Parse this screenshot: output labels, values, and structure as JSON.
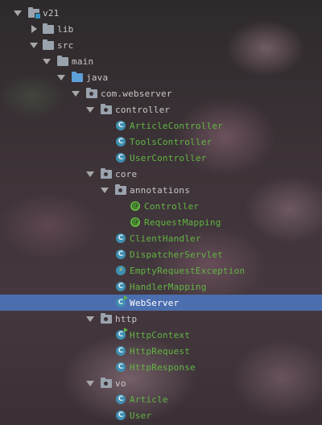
{
  "colors": {
    "selection": "#4b6eaf",
    "class_icon": "#3e8fb0",
    "annotation_icon": "#62b543",
    "changed_file_text": "#62b543",
    "plain_text": "#c8c8c8"
  },
  "tree": [
    {
      "label": "v21",
      "expanded": true,
      "icon": "module-folder-icon",
      "style": "plain"
    },
    {
      "label": "lib",
      "expanded": false,
      "icon": "folder-icon",
      "style": "plain"
    },
    {
      "label": "src",
      "expanded": true,
      "icon": "folder-icon",
      "style": "plain"
    },
    {
      "label": "main",
      "expanded": true,
      "icon": "folder-icon",
      "style": "plain"
    },
    {
      "label": "java",
      "expanded": true,
      "icon": "source-folder-icon",
      "style": "plain"
    },
    {
      "label": "com.webserver",
      "expanded": true,
      "icon": "package-icon",
      "style": "plain"
    },
    {
      "label": "controller",
      "expanded": true,
      "icon": "package-icon",
      "style": "plain"
    },
    {
      "label": "ArticleController",
      "icon": "class-icon",
      "style": "green"
    },
    {
      "label": "ToolsController",
      "icon": "class-icon",
      "style": "green"
    },
    {
      "label": "UserController",
      "icon": "class-icon",
      "style": "green"
    },
    {
      "label": "core",
      "expanded": true,
      "icon": "package-icon",
      "style": "plain"
    },
    {
      "label": "annotations",
      "expanded": true,
      "icon": "package-icon",
      "style": "plain"
    },
    {
      "label": "Controller",
      "icon": "annotation-icon",
      "style": "green"
    },
    {
      "label": "RequestMapping",
      "icon": "annotation-icon",
      "style": "green"
    },
    {
      "label": "ClientHandler",
      "icon": "class-icon",
      "style": "green"
    },
    {
      "label": "DispatcherServlet",
      "icon": "class-icon",
      "style": "green"
    },
    {
      "label": "EmptyRequestException",
      "icon": "exception-class-icon",
      "style": "green"
    },
    {
      "label": "HandlerMapping",
      "icon": "class-icon",
      "style": "green"
    },
    {
      "label": "WebServer",
      "icon": "runnable-class-icon",
      "style": "selected",
      "selected": true
    },
    {
      "label": "http",
      "expanded": true,
      "icon": "package-icon",
      "style": "plain"
    },
    {
      "label": "HttpContext",
      "icon": "runnable-class-icon",
      "style": "green"
    },
    {
      "label": "HttpRequest",
      "icon": "class-icon",
      "style": "green"
    },
    {
      "label": "HttpResponse",
      "icon": "class-icon",
      "style": "green"
    },
    {
      "label": "vo",
      "expanded": true,
      "icon": "package-icon",
      "style": "plain"
    },
    {
      "label": "Article",
      "icon": "class-icon",
      "style": "green"
    },
    {
      "label": "User",
      "icon": "class-icon",
      "style": "green"
    }
  ]
}
